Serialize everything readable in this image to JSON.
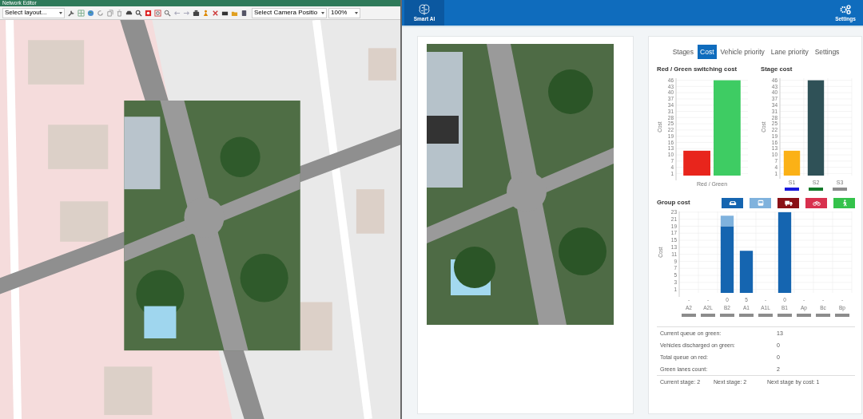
{
  "editor": {
    "title": "Network Editor",
    "layout_select": {
      "value": "Select layout..."
    },
    "camera_select": {
      "value": "Select Camera Positio"
    },
    "zoom_select": {
      "value": "100%"
    }
  },
  "header": {
    "app_name": "Smart AI",
    "settings_label": "Settings"
  },
  "panel": {
    "tabs": [
      {
        "label": "Stages",
        "selected": false
      },
      {
        "label": "Cost",
        "selected": true
      },
      {
        "label": "Vehicle priority",
        "selected": false
      },
      {
        "label": "Lane priority",
        "selected": false
      },
      {
        "label": "Settings",
        "selected": false
      }
    ],
    "switching_cost": {
      "chart_data": {
        "type": "bar",
        "title": "Red / Green switching cost",
        "ylabel": "Cost",
        "categories": [
          "Red / Green"
        ],
        "stacked": false,
        "grid": true,
        "ylim": [
          0,
          47
        ],
        "yticks": [
          1,
          4,
          7,
          10,
          13,
          16,
          19,
          22,
          25,
          28,
          31,
          34,
          37,
          40,
          43,
          46
        ],
        "series": [
          {
            "color": "#e8251c",
            "values": [
              12
            ]
          },
          {
            "color": "#3ecc63",
            "values": [
              46
            ]
          }
        ]
      }
    },
    "stage_cost": {
      "chart_data": {
        "type": "bar",
        "title": "Stage cost",
        "ylabel": "Cost",
        "categories": [
          "S1",
          "S2",
          "S3"
        ],
        "stacked": true,
        "grid": true,
        "ylim": [
          0,
          47
        ],
        "yticks": [
          1,
          4,
          7,
          10,
          13,
          16,
          19,
          22,
          25,
          28,
          31,
          34,
          37,
          40,
          43,
          46
        ],
        "series": [
          {
            "color": "#fbb116",
            "values": [
              12,
              null,
              null
            ]
          },
          {
            "color": "#2f5157",
            "values": [
              null,
              46,
              null
            ]
          }
        ]
      },
      "stage_colors": [
        {
          "color": "#1a1adc"
        },
        {
          "color": "#137a2a"
        },
        {
          "color": "#8c8c8c"
        }
      ]
    },
    "group_cost": {
      "vehicle_filters": [
        {
          "kind": "car",
          "color": "#1565b0"
        },
        {
          "kind": "bus",
          "color": "#7fb2dd"
        },
        {
          "kind": "truck",
          "color": "#8a1015"
        },
        {
          "kind": "bike",
          "color": "#d8304e"
        },
        {
          "kind": "pedestrian",
          "color": "#34c24b"
        }
      ],
      "chart_data": {
        "type": "bar",
        "title": "Group cost",
        "ylabel": "Cost",
        "categories": [
          "A2",
          "A2L",
          "B2",
          "A1",
          "A1L",
          "B1",
          "Ap",
          "Bc",
          "Bp"
        ],
        "stacked": true,
        "grid": true,
        "ylim": [
          0,
          23.2
        ],
        "yticks": [
          1,
          3,
          5,
          7,
          9,
          11,
          13,
          15,
          17,
          19,
          21,
          23
        ],
        "series": [
          {
            "color": "#1565b0",
            "values": [
              null,
              null,
              19,
              12,
              null,
              23,
              null,
              null,
              null
            ]
          },
          {
            "color": "#7fb2dd",
            "values": [
              null,
              null,
              3,
              null,
              null,
              null,
              null,
              null,
              null
            ]
          }
        ]
      },
      "group_values": [
        "-",
        "-",
        "0",
        "5",
        "-",
        "0",
        "-",
        "-",
        "-"
      ]
    },
    "stats": [
      {
        "label": "Current queue on green:",
        "value": "13"
      },
      {
        "label": "Vehicles discharged on green:",
        "value": "0"
      },
      {
        "label": "Total queue on red:",
        "value": "0"
      },
      {
        "label": "Green lanes count:",
        "value": "2"
      }
    ],
    "footer": [
      "Current stage: 2",
      "Next stage: 2",
      "Next stage by cost: 1"
    ]
  }
}
